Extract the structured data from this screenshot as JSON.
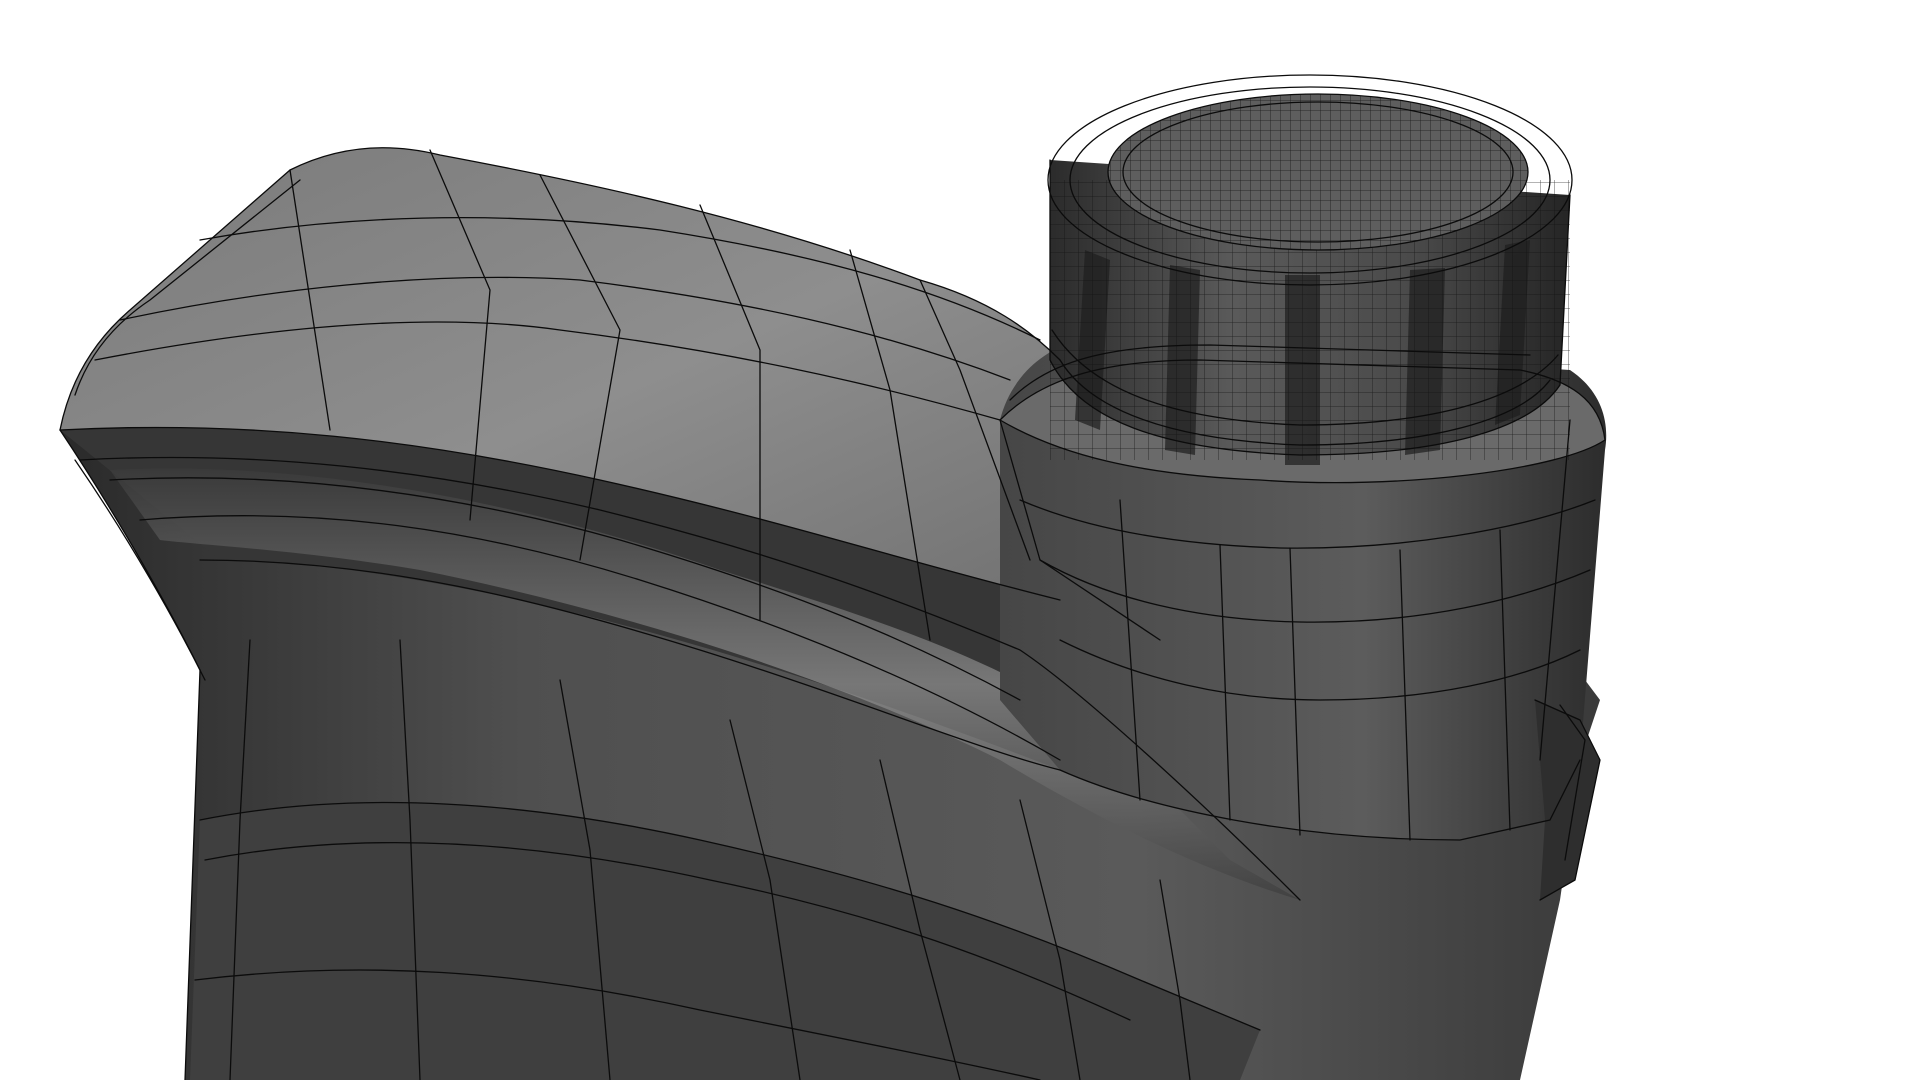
{
  "scene": {
    "subject": "oil-bottle-wireframe-render",
    "colors": {
      "background": "#ffffff",
      "body_light": "#8a8a8a",
      "body_mid": "#5e5e5e",
      "body_dark": "#2e2e2e",
      "body_shadow": "#1c1c1c",
      "wireframe": "#0b0b0b"
    }
  }
}
